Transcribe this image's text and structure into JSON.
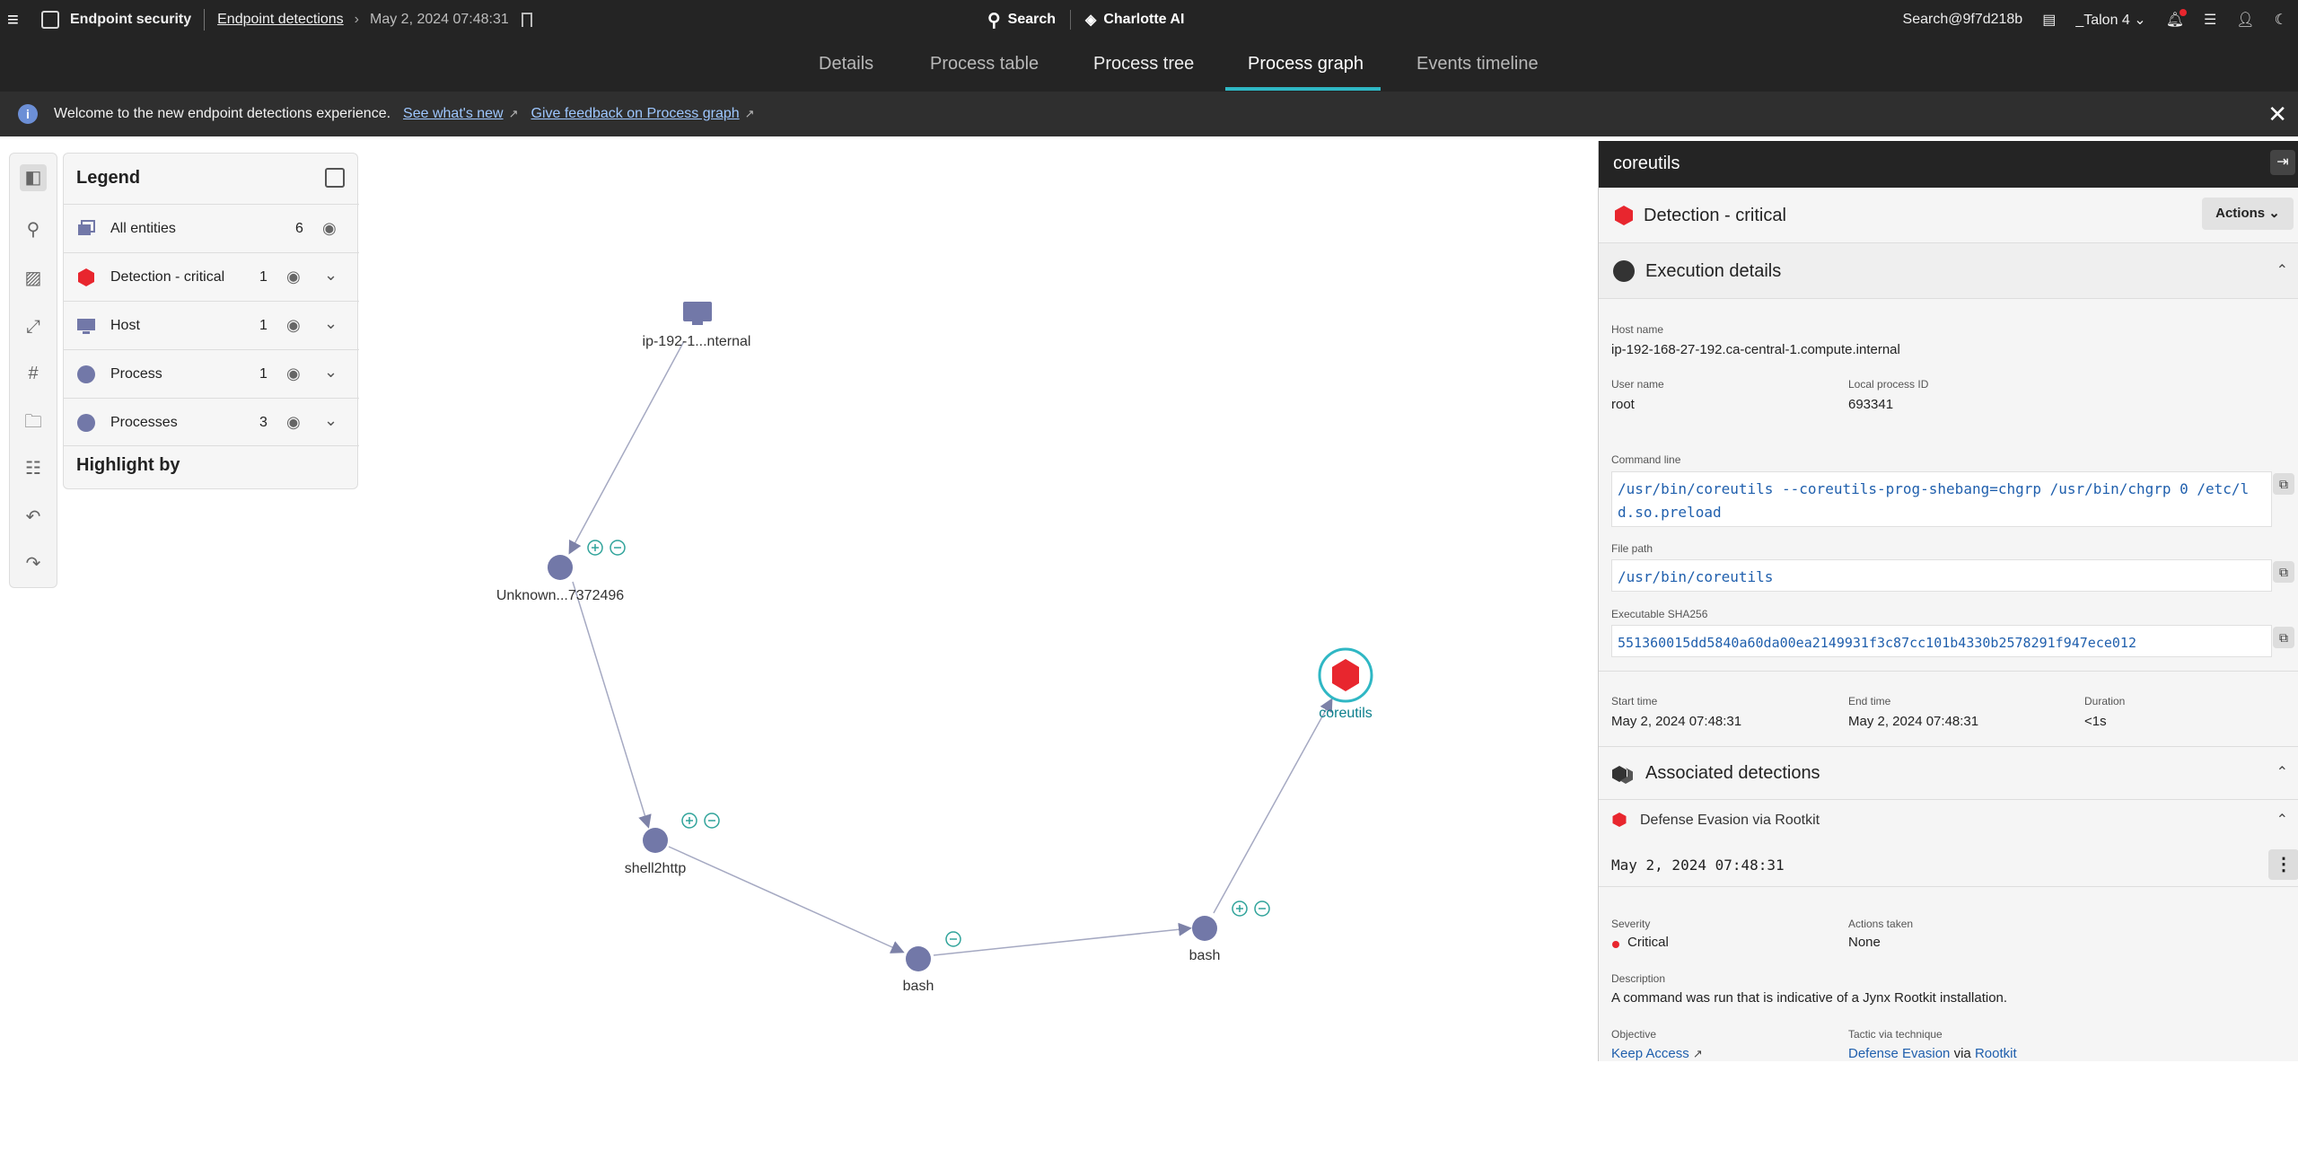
{
  "topbar": {
    "app_name": "Endpoint security",
    "breadcrumb_link": "Endpoint detections",
    "breadcrumb_date": "May 2, 2024 07:48:31",
    "search_label": "Search",
    "ai_label": "Charlotte AI",
    "user_account": "Search@9f7d218b",
    "tenant": "_Talon 4"
  },
  "tabs": [
    {
      "label": "Details"
    },
    {
      "label": "Process table"
    },
    {
      "label": "Process tree"
    },
    {
      "label": "Process graph"
    },
    {
      "label": "Events timeline"
    }
  ],
  "banner": {
    "text": "Welcome to the new endpoint detections experience.",
    "link1": "See what's new",
    "link2": "Give feedback on Process graph"
  },
  "legend": {
    "title": "Legend",
    "rows": [
      {
        "label": "All entities",
        "count": "6"
      },
      {
        "label": "Detection - critical",
        "count": "1"
      },
      {
        "label": "Host",
        "count": "1"
      },
      {
        "label": "Process",
        "count": "1"
      },
      {
        "label": "Processes",
        "count": "3"
      }
    ],
    "highlight_title": "Highlight by"
  },
  "graph": {
    "nodes": [
      {
        "label": "ip-192-1...nternal"
      },
      {
        "label": "Unknown...7372496"
      },
      {
        "label": "shell2http"
      },
      {
        "label": "bash"
      },
      {
        "label": "bash"
      },
      {
        "label": "coreutils"
      }
    ]
  },
  "panel": {
    "title": "coreutils",
    "detection_label": "Detection - critical",
    "actions_label": "Actions",
    "execution_title": "Execution details",
    "host_name_label": "Host name",
    "host_name": "ip-192-168-27-192.ca-central-1.compute.internal",
    "user_name_label": "User name",
    "user_name": "root",
    "pid_label": "Local process ID",
    "pid": "693341",
    "cmd_label": "Command line",
    "cmd": "/usr/bin/coreutils --coreutils-prog-shebang=chgrp /usr/bin/chgrp 0 /etc/ld.so.preload",
    "path_label": "File path",
    "path": "/usr/bin/coreutils",
    "sha_label": "Executable SHA256",
    "sha": "551360015dd5840a60da00ea2149931f3c87cc101b4330b2578291f947ece012",
    "start_label": "Start time",
    "start": "May 2, 2024 07:48:31",
    "end_label": "End time",
    "end": "May 2, 2024 07:48:31",
    "duration_label": "Duration",
    "duration": "<1s",
    "assoc_title": "Associated detections",
    "assoc_name": "Defense Evasion via Rootkit",
    "assoc_time": "May 2, 2024 07:48:31",
    "severity_label": "Severity",
    "severity": "Critical",
    "actions_taken_label": "Actions taken",
    "actions_taken": "None",
    "desc_label": "Description",
    "desc": "A command was run that is indicative of a Jynx Rootkit installation.",
    "objective_label": "Objective",
    "objective": "Keep Access",
    "tactic_label": "Tactic via technique",
    "tactic": "Defense Evasion",
    "via": "via",
    "technique": "Rootkit"
  },
  "colors": {
    "critical": "#e8262e",
    "node": "#7278a8",
    "accent": "#2fb7c4"
  }
}
